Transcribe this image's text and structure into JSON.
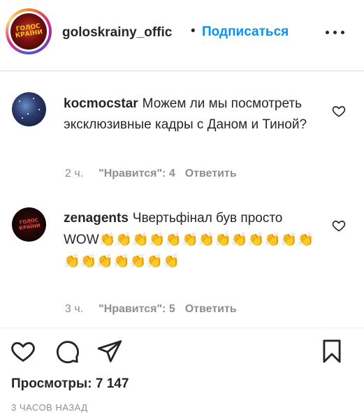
{
  "header": {
    "avatar_logo": "ГОЛОС КРАЇНИ",
    "username": "goloskrainy_offic",
    "separator": "•",
    "follow_label": "Подписаться"
  },
  "comments": [
    {
      "username": "kocmocstar",
      "text": "Можем ли мы посмотреть эксклюзивные кадры с Даном и Тиной?",
      "time": "2 ч.",
      "likes": "\"Нравится\": 4",
      "reply": "Ответить"
    },
    {
      "username": "zenagents",
      "avatar_logo": "ГОЛОС КРАЇНИ",
      "text": "Чвертьфінал був просто WOW",
      "emojis": "👏👏👏👏👏👏👏👏👏👏👏👏👏👏👏👏👏👏👏👏",
      "time": "3 ч.",
      "likes": "\"Нравится\": 5",
      "reply": "Ответить"
    }
  ],
  "stats": {
    "views": "Просмотры: 7 147",
    "timestamp": "3 ЧАСОВ НАЗАД"
  },
  "icons": {
    "like": "heart-icon",
    "comment": "comment-icon",
    "share": "paper-plane-icon",
    "save": "bookmark-icon",
    "more": "more-dots-icon"
  },
  "colors": {
    "accent": "#0095f6",
    "text": "#262626",
    "secondary": "#8e8e8e",
    "divider": "#dbdbdb"
  }
}
